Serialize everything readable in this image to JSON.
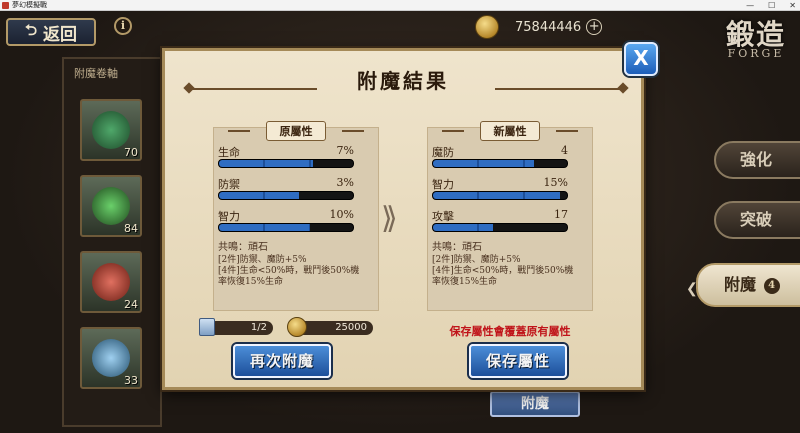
{
  "window": {
    "title": "夢幻模擬戰",
    "minimize": "—",
    "maximize": "☐",
    "close": "✕"
  },
  "topbar": {
    "back_label": "返回",
    "info_label": "i",
    "currency_value": "75844446",
    "plus_label": "+"
  },
  "forge": {
    "title": "鍛造",
    "subtitle": "FORGE"
  },
  "left_panel": {
    "title": "附魔卷軸",
    "items": [
      {
        "count": "70"
      },
      {
        "count": "84"
      },
      {
        "count": "24"
      },
      {
        "count": "33"
      }
    ]
  },
  "side_tabs": {
    "enhance": "強化",
    "breakthrough": "突破",
    "enchant": "附魔",
    "enchant_badge": "4"
  },
  "background_button": "附魔",
  "modal": {
    "title": "附魔結果",
    "close_label": "X",
    "original": {
      "header": "原屬性",
      "stats": [
        {
          "name": "生命",
          "value": "7%",
          "fill": 0.7
        },
        {
          "name": "防禦",
          "value": "3%",
          "fill": 0.6
        },
        {
          "name": "智力",
          "value": "10%",
          "fill": 0.68
        }
      ],
      "resonance_title": "共鳴：頑石",
      "resonance_lines": [
        "[2件]防禦、魔防+5%",
        "[4件]生命<50%時，戰鬥後50%機",
        "率恢復15%生命"
      ]
    },
    "new": {
      "header": "新屬性",
      "stats": [
        {
          "name": "魔防",
          "value": "4",
          "fill": 0.75
        },
        {
          "name": "智力",
          "value": "15%",
          "fill": 0.95
        },
        {
          "name": "攻擊",
          "value": "17",
          "fill": 0.45
        }
      ],
      "resonance_title": "共鳴：頑石",
      "resonance_lines": [
        "[2件]防禦、魔防+5%",
        "[4件]生命<50%時，戰鬥後50%機",
        "率恢復15%生命"
      ]
    },
    "arrow": "⟫",
    "cost": {
      "scrolls": "1/2",
      "gold": "25000"
    },
    "warning": "保存屬性會覆蓋原有屬性",
    "retry_label": "再次附魔",
    "save_label": "保存屬性"
  }
}
